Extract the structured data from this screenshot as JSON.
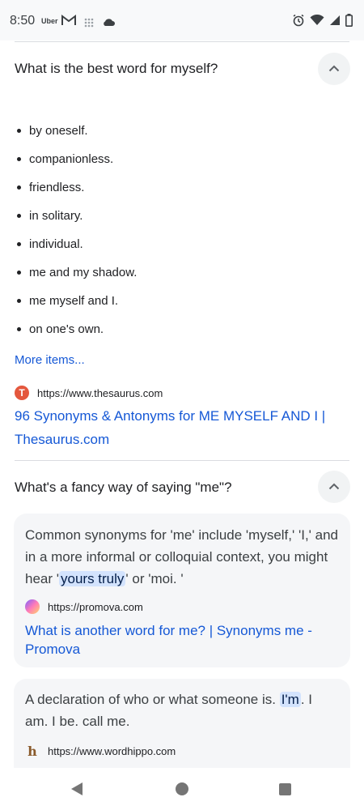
{
  "status_bar": {
    "time": "8:50",
    "uber_label": "Uber",
    "icons": [
      "gmail-icon",
      "grid-icon",
      "cloud-icon",
      "alarm-icon",
      "wifi-icon",
      "signal-icon",
      "battery-icon"
    ]
  },
  "faq1": {
    "question": "What is the best word for myself?",
    "items": [
      "by oneself.",
      "companionless.",
      "friendless.",
      "in solitary.",
      "individual.",
      "me and my shadow.",
      "me myself and I.",
      "on one's own."
    ],
    "more_items": "More items...",
    "source_url": "https://www.thesaurus.com",
    "result_title": "96 Synonyms & Antonyms for ME MYSELF AND I | Thesaurus.com"
  },
  "faq2": {
    "question": "What's a fancy way of saying \"me\"?",
    "card1": {
      "text_before": "Common synonyms for 'me' include 'myself,' 'I,' and in a more informal or colloquial context, you might hear '",
      "highlight": "yours truly",
      "text_after": "' or 'moi. '",
      "source_url": "https://promova.com",
      "title": "What is another word for me? | Synonyms me - Promova"
    },
    "card2": {
      "text_before": "A declaration of who or what someone is. ",
      "highlight": "I'm",
      "text_after": ". I am. I be. call me.",
      "source_url": "https://www.wordhippo.com"
    }
  },
  "colors": {
    "link": "#1558d6",
    "highlight_bg": "#d3e3fd",
    "card_bg": "#f5f6f8"
  }
}
